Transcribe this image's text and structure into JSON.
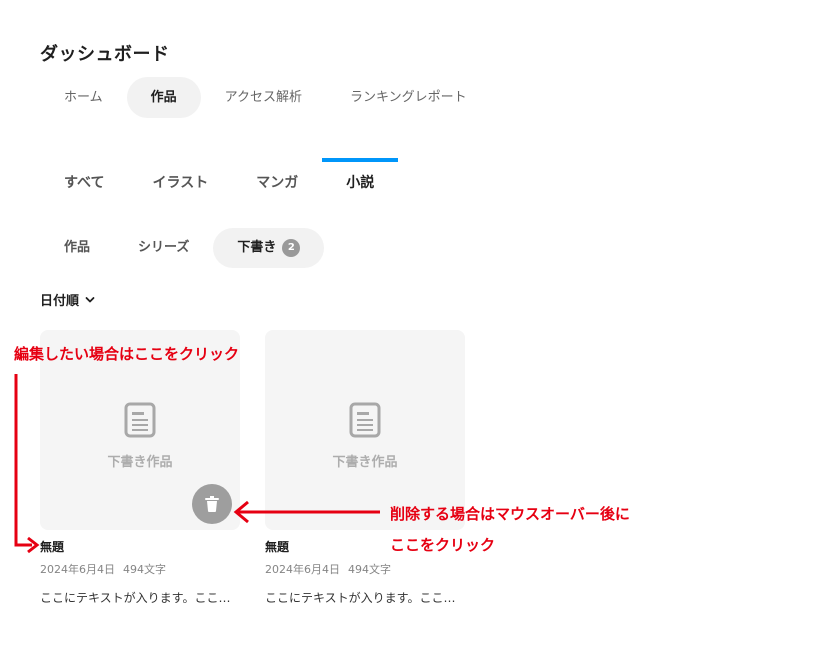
{
  "page_title": "ダッシュボード",
  "nav": {
    "items": [
      {
        "label": "ホーム",
        "active": false
      },
      {
        "label": "作品",
        "active": true
      },
      {
        "label": "アクセス解析",
        "active": false
      },
      {
        "label": "ランキングレポート",
        "active": false
      }
    ]
  },
  "category_tabs": [
    {
      "label": "すべて",
      "active": false
    },
    {
      "label": "イラスト",
      "active": false
    },
    {
      "label": "マンガ",
      "active": false
    },
    {
      "label": "小説",
      "active": true
    }
  ],
  "sub_tabs": [
    {
      "label": "作品",
      "active": false
    },
    {
      "label": "シリーズ",
      "active": false
    },
    {
      "label": "下書き",
      "active": true,
      "badge": "2"
    }
  ],
  "sort": {
    "label": "日付順"
  },
  "cards": [
    {
      "thumb_label": "下書き作品",
      "title": "無題",
      "date": "2024年6月4日",
      "chars": "494文字",
      "excerpt": "ここにテキストが入ります。ここにテキ..."
    },
    {
      "thumb_label": "下書き作品",
      "title": "無題",
      "date": "2024年6月4日",
      "chars": "494文字",
      "excerpt": "ここにテキストが入ります。ここにテキ..."
    }
  ],
  "annotations": {
    "edit_note": "編集したい場合はここをクリック",
    "delete_note_line1": "削除する場合はマウスオーバー後に",
    "delete_note_line2": "ここをクリック",
    "color": "#e60012"
  },
  "colors": {
    "accent": "#0096fa",
    "pill_bg": "#f2f2f2",
    "badge_bg": "#999999"
  }
}
